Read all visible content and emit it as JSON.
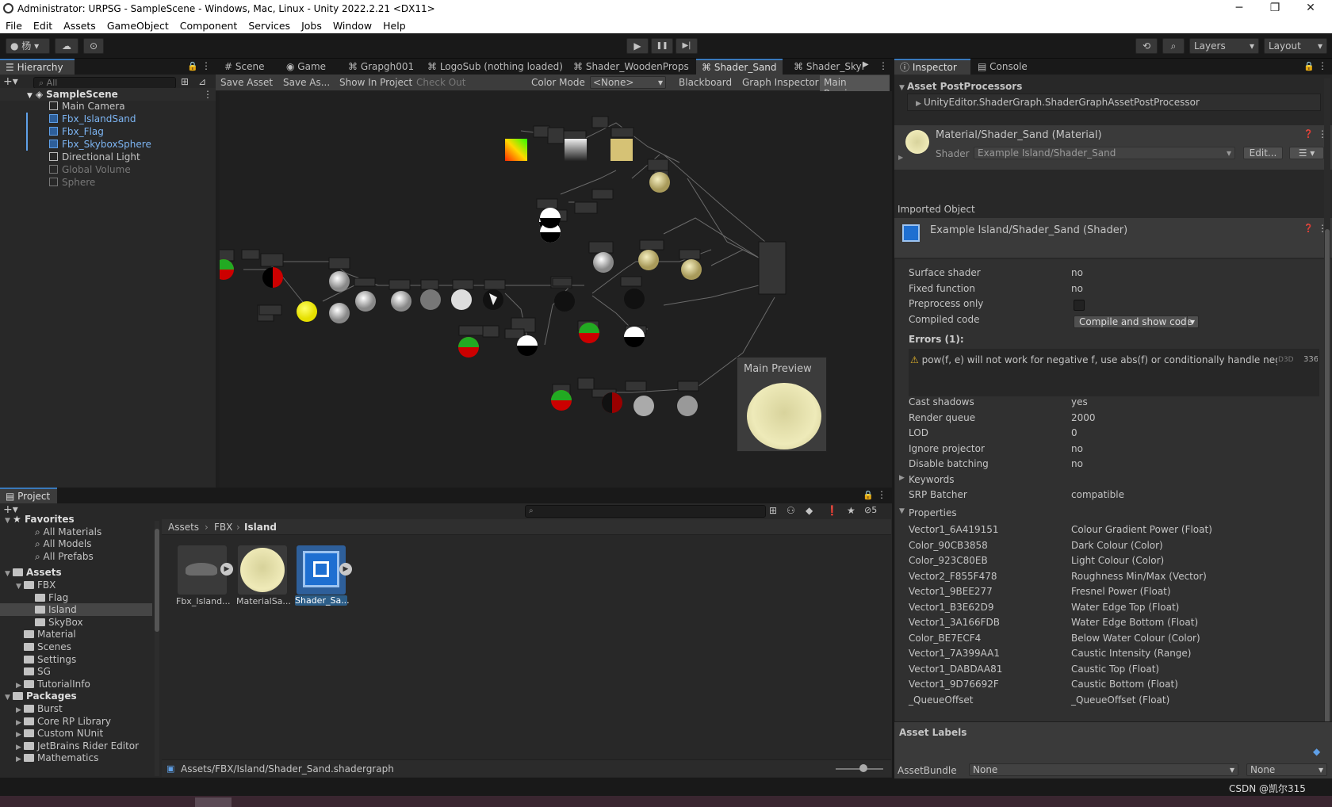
{
  "window": {
    "title": "Administrator: URPSG - SampleScene - Windows, Mac, Linux - Unity 2022.2.21 <DX11>",
    "min": "─",
    "max": "❐",
    "close": "✕"
  },
  "menu": [
    "File",
    "Edit",
    "Assets",
    "GameObject",
    "Component",
    "Services",
    "Jobs",
    "Window",
    "Help"
  ],
  "toolbar": {
    "account": "杨",
    "play": "▶",
    "pause": "❚❚",
    "step": "▶|",
    "layers": "Layers",
    "layout": "Layout"
  },
  "hierarchy": {
    "tab": "Hierarchy",
    "search_placeholder": "All",
    "scene": "SampleScene",
    "items": [
      {
        "label": "Main Camera",
        "kind": "normal"
      },
      {
        "label": "Fbx_IslandSand",
        "kind": "prefab"
      },
      {
        "label": "Fbx_Flag",
        "kind": "prefab"
      },
      {
        "label": "Fbx_SkyboxSphere",
        "kind": "prefab"
      },
      {
        "label": "Directional Light",
        "kind": "normal"
      },
      {
        "label": "Global Volume",
        "kind": "disabled"
      },
      {
        "label": "Sphere",
        "kind": "disabled"
      }
    ]
  },
  "center_tabs": [
    "Scene",
    "Game",
    "Grapgh001",
    "LogoSub (nothing loaded)",
    "Shader_WoodenProps",
    "Shader_Sand",
    "Shader_Skyl"
  ],
  "graph_toolbar": {
    "save_asset": "Save Asset",
    "save_as": "Save As...",
    "show_in_project": "Show In Project",
    "check_out": "Check Out",
    "color_mode_label": "Color Mode",
    "color_mode_value": "<None>",
    "blackboard": "Blackboard",
    "graph_inspector": "Graph Inspector",
    "main_preview": "Main Preview"
  },
  "main_preview": {
    "title": "Main Preview"
  },
  "inspector": {
    "tab": "Inspector",
    "console_tab": "Console",
    "post_processors_title": "Asset PostProcessors",
    "post_processor": "UnityEditor.ShaderGraph.ShaderGraphAssetPostProcessor",
    "material_title": "Material/Shader_Sand (Material)",
    "shader_label": "Shader",
    "shader_value": "Example Island/Shader_Sand",
    "edit": "Edit...",
    "imported_object": "Imported Object",
    "shader_title": "Example Island/Shader_Sand (Shader)",
    "rows": [
      {
        "k": "Surface shader",
        "v": "no"
      },
      {
        "k": "Fixed function",
        "v": "no"
      },
      {
        "k": "Preprocess only",
        "v": ""
      },
      {
        "k": "Compiled code",
        "v": ""
      }
    ],
    "compile_btn": "Compile and show code",
    "errors_title": "Errors (1):",
    "error_msg": "pow(f, e) will not work for negative f, use abs(f) or conditionally handle negative",
    "error_api": "D3D",
    "error_line": "336",
    "rows2": [
      {
        "k": "Cast shadows",
        "v": "yes"
      },
      {
        "k": "Render queue",
        "v": "2000"
      },
      {
        "k": "LOD",
        "v": "0"
      },
      {
        "k": "Ignore projector",
        "v": "no"
      },
      {
        "k": "Disable batching",
        "v": "no"
      }
    ],
    "keywords": "Keywords",
    "srp_label": "SRP Batcher",
    "srp_value": "compatible",
    "properties_title": "Properties",
    "props": [
      {
        "k": "Vector1_6A419151",
        "v": "Colour Gradient Power (Float)"
      },
      {
        "k": "Color_90CB3858",
        "v": "Dark Colour (Color)"
      },
      {
        "k": "Color_923C80EB",
        "v": "Light Colour (Color)"
      },
      {
        "k": "Vector2_F855F478",
        "v": "Roughness Min/Max (Vector)"
      },
      {
        "k": "Vector1_9BEE277",
        "v": "Fresnel Power (Float)"
      },
      {
        "k": "Vector1_B3E62D9",
        "v": "Water Edge Top (Float)"
      },
      {
        "k": "Vector1_3A166FDB",
        "v": "Water Edge Bottom (Float)"
      },
      {
        "k": "Color_BE7ECF4",
        "v": "Below Water Colour (Color)"
      },
      {
        "k": "Vector1_7A399AA1",
        "v": "Caustic Intensity (Range)"
      },
      {
        "k": "Vector1_DABDAA81",
        "v": "Caustic Top (Float)"
      },
      {
        "k": "Vector1_9D76692F",
        "v": "Caustic Bottom (Float)"
      },
      {
        "k": "_QueueOffset",
        "v": "_QueueOffset (Float)"
      }
    ],
    "asset_labels": "Asset Labels",
    "assetbundle_label": "AssetBundle",
    "assetbundle_value": "None",
    "assetbundle_variant": "None"
  },
  "project": {
    "tab": "Project",
    "favorites": "Favorites",
    "fav_items": [
      "All Materials",
      "All Models",
      "All Prefabs"
    ],
    "assets": "Assets",
    "fbx": "FBX",
    "fbx_children": [
      "Flag",
      "Island",
      "SkyBox"
    ],
    "asset_children": [
      "Material",
      "Scenes",
      "Settings",
      "SG",
      "TutorialInfo"
    ],
    "packages": "Packages",
    "package_items": [
      "Burst",
      "Core RP Library",
      "Custom NUnit",
      "JetBrains Rider Editor",
      "Mathematics"
    ],
    "breadcrumb": [
      "Assets",
      "FBX",
      "Island"
    ],
    "files": [
      "Fbx_Island...",
      "MaterialSa...",
      "Shader_Sa..."
    ],
    "path": "Assets/FBX/Island/Shader_Sand.shadergraph",
    "hidden_count": "5"
  },
  "watermark": "CSDN @凯尔315"
}
